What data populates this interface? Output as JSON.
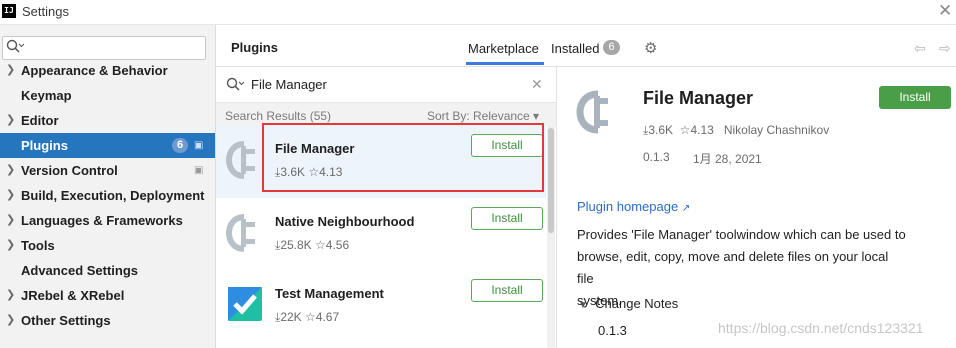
{
  "window": {
    "title": "Settings",
    "app_icon_text": "IJ"
  },
  "sidebar": {
    "search_placeholder": "",
    "items": [
      {
        "label": "Appearance & Behavior",
        "expandable": true
      },
      {
        "label": "Keymap",
        "expandable": false
      },
      {
        "label": "Editor",
        "expandable": true
      },
      {
        "label": "Plugins",
        "expandable": false,
        "selected": true,
        "badge": "6"
      },
      {
        "label": "Version Control",
        "expandable": true
      },
      {
        "label": "Build, Execution, Deployment",
        "expandable": true
      },
      {
        "label": "Languages & Frameworks",
        "expandable": true
      },
      {
        "label": "Tools",
        "expandable": true
      },
      {
        "label": "Advanced Settings",
        "expandable": false
      },
      {
        "label": "JRebel & XRebel",
        "expandable": true
      },
      {
        "label": "Other Settings",
        "expandable": true
      }
    ]
  },
  "header": {
    "title": "Plugins",
    "tabs": {
      "marketplace": "Marketplace",
      "installed": "Installed",
      "installed_count": "6"
    }
  },
  "search": {
    "query": "File Manager"
  },
  "results": {
    "count_label": "Search Results (55)",
    "sort_label": "Sort By: Relevance"
  },
  "plugins": [
    {
      "name": "File Manager",
      "downloads": "3.6K",
      "rating": "4.13",
      "button": "Install"
    },
    {
      "name": "Native Neighbourhood",
      "downloads": "25.8K",
      "rating": "4.56",
      "button": "Install"
    },
    {
      "name": "Test Management",
      "downloads": "22K",
      "rating": "4.67",
      "button": "Install"
    }
  ],
  "detail": {
    "name": "File Manager",
    "install_label": "Install",
    "downloads": "3.6K",
    "rating": "4.13",
    "vendor": "Nikolay Chashnikov",
    "version": "0.1.3",
    "date": "1月 28, 2021",
    "homepage_label": "Plugin homepage",
    "description_lines": [
      "Provides 'File Manager' toolwindow which can be used to",
      "browse, edit, copy, move and delete files on your local file",
      "system."
    ],
    "change_notes_label": "Change Notes",
    "change_notes_version": "0.1.3"
  },
  "watermark": "https://blog.csdn.net/cnds123321",
  "colors": {
    "accent": "#2675bf",
    "install_green": "#4a9e47",
    "highlight": "#e03a3a",
    "link": "#2b6cc9"
  }
}
